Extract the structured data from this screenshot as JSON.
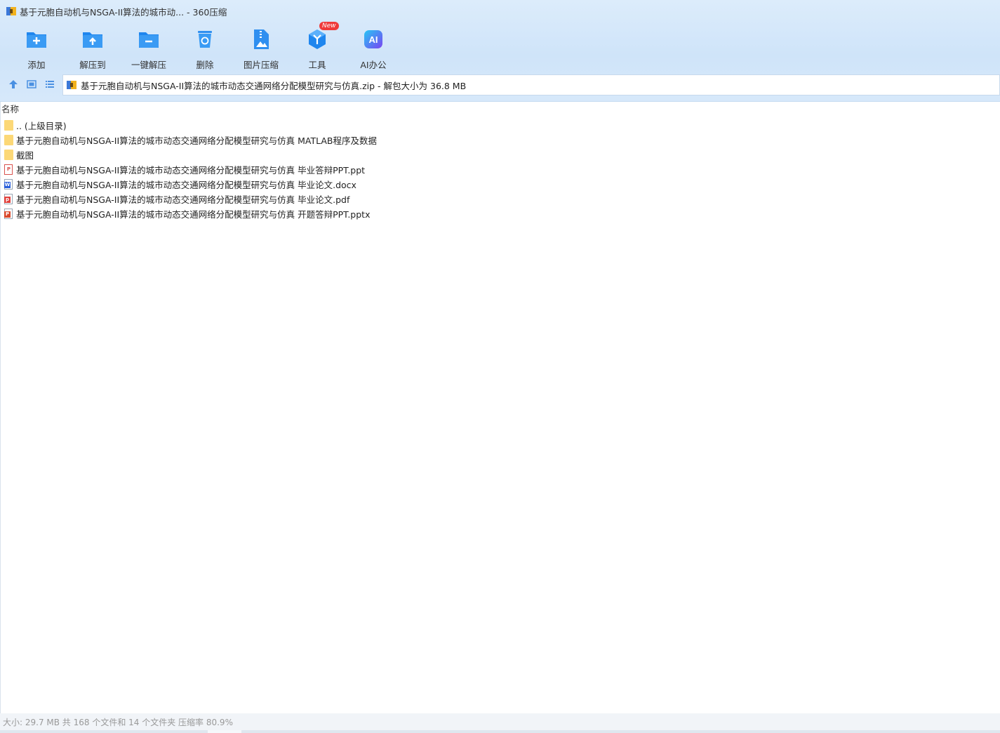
{
  "window": {
    "title": "基于元胞自动机与NSGA-II算法的城市动... - 360压缩"
  },
  "toolbar": {
    "items": [
      {
        "label": "添加",
        "icon": "folder-add-icon",
        "color": "#2f8ff0"
      },
      {
        "label": "解压到",
        "icon": "folder-extract-icon",
        "color": "#2f8ff0"
      },
      {
        "label": "一键解压",
        "icon": "folder-oneclick-icon",
        "color": "#2f8ff0"
      },
      {
        "label": "删除",
        "icon": "recycle-bin-icon",
        "color": "#2f8ff0"
      },
      {
        "label": "图片压缩",
        "icon": "image-zip-icon",
        "color": "#2f8ff0"
      },
      {
        "label": "工具",
        "icon": "tools-cube-icon",
        "color": "#2f8ff0",
        "badge": "New"
      },
      {
        "label": "AI办公",
        "icon": "ai-office-icon",
        "color": "#3b6cf0"
      }
    ]
  },
  "address": {
    "text": "基于元胞自动机与NSGA-II算法的城市动态交通网络分配模型研究与仿真.zip - 解包大小为 36.8 MB"
  },
  "list": {
    "column_name": "名称",
    "rows": [
      {
        "name": ".. (上级目录)",
        "type": "folder"
      },
      {
        "name": "基于元胞自动机与NSGA-II算法的城市动态交通网络分配模型研究与仿真 MATLAB程序及数据",
        "type": "folder"
      },
      {
        "name": "截图",
        "type": "folder"
      },
      {
        "name": "基于元胞自动机与NSGA-II算法的城市动态交通网络分配模型研究与仿真 毕业答辩PPT.ppt",
        "type": "ppt"
      },
      {
        "name": "基于元胞自动机与NSGA-II算法的城市动态交通网络分配模型研究与仿真 毕业论文.docx",
        "type": "docx"
      },
      {
        "name": "基于元胞自动机与NSGA-II算法的城市动态交通网络分配模型研究与仿真 毕业论文.pdf",
        "type": "pdf"
      },
      {
        "name": "基于元胞自动机与NSGA-II算法的城市动态交通网络分配模型研究与仿真 开题答辩PPT.pptx",
        "type": "pptx"
      }
    ]
  },
  "status": {
    "text": "大小: 29.7 MB 共 168 个文件和 14 个文件夹 压缩率 80.9%"
  }
}
